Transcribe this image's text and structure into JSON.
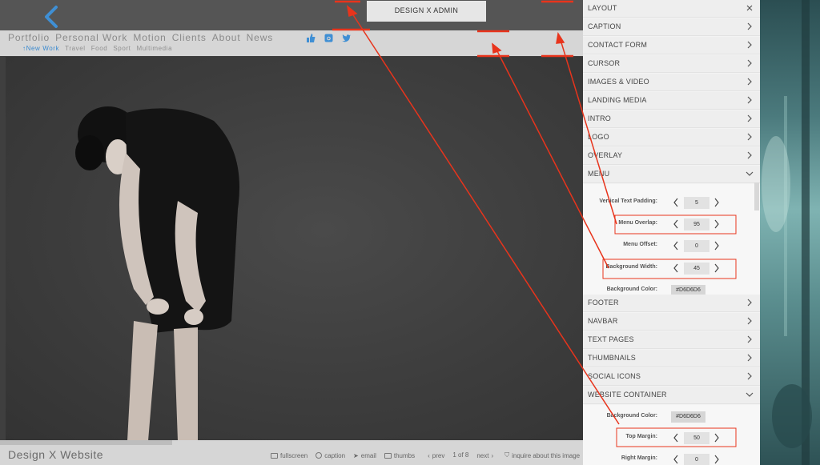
{
  "admin": {
    "title": "DESIGN X ADMIN"
  },
  "site": {
    "menu": [
      "Portfolio",
      "Personal Work",
      "Motion",
      "Clients",
      "About",
      "News"
    ],
    "submenu": [
      "↑New Work",
      "Travel",
      "Food",
      "Sport",
      "Multimedia"
    ],
    "social_icons": [
      "thumbs-up-icon",
      "instagram-icon",
      "twitter-icon"
    ],
    "footer": {
      "title": "Design X Website",
      "fullscreen": "fullscreen",
      "caption": "caption",
      "email": "email",
      "thumbs": "thumbs",
      "prev": "prev",
      "page": "1 of 8",
      "next": "next",
      "inquire": "inquire about this image"
    }
  },
  "panel": {
    "top_sections": [
      "LAYOUT",
      "CAPTION",
      "CONTACT FORM",
      "CURSOR",
      "IMAGES & VIDEO",
      "LANDING MEDIA",
      "INTRO",
      "LOGO",
      "OVERLAY",
      "MENU"
    ],
    "menu_settings": {
      "vertical_text_padding": {
        "label": "Vertical Text Padding:",
        "value": "5"
      },
      "menu_overlap": {
        "label": "Menu Overlap:",
        "value": "95"
      },
      "menu_offset": {
        "label": "Menu Offset:",
        "value": "0"
      },
      "background_width": {
        "label": "Background Width:",
        "value": "45"
      },
      "background_color": {
        "label": "Background Color:",
        "value": "#D6D6D6"
      }
    },
    "bottom_sections": [
      "FOOTER",
      "NAVBAR",
      "TEXT PAGES",
      "THUMBNAILS",
      "SOCIAL ICONS",
      "WEBSITE CONTAINER"
    ],
    "container_settings": {
      "background_color": {
        "label": "Background Color:",
        "value": "#D6D6D6"
      },
      "top_margin": {
        "label": "Top Margin:",
        "value": "50"
      },
      "right_margin": {
        "label": "Right Margin:",
        "value": "0"
      }
    }
  },
  "colors": {
    "accent": "#3a8ad0",
    "annotation": "#e8341c",
    "navbar_bg": "#D6D6D6"
  }
}
